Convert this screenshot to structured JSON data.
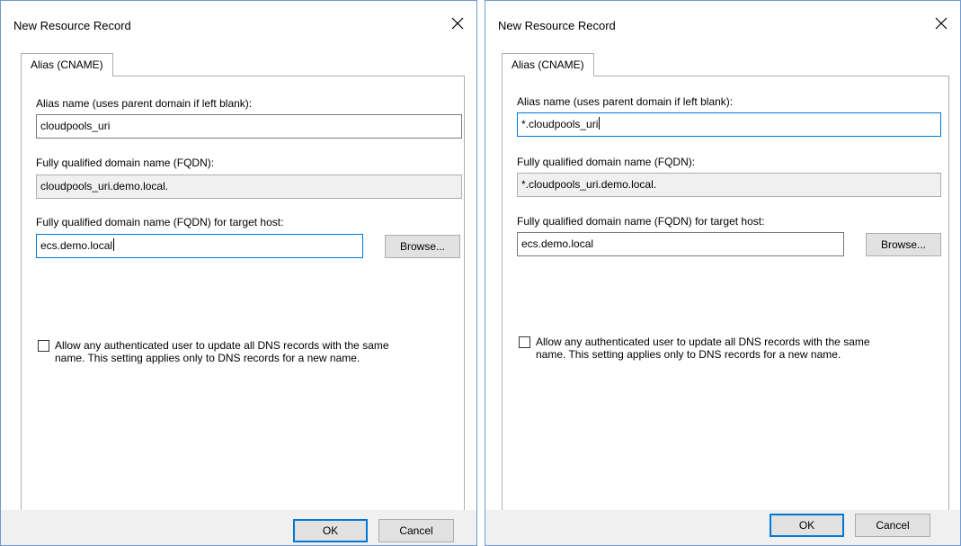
{
  "dialogs": [
    {
      "title": "New Resource Record",
      "tab_label": "Alias (CNAME)",
      "alias_label": "Alias name (uses parent domain if left blank):",
      "alias_value": "cloudpools_uri",
      "fqdn_label": "Fully qualified domain name (FQDN):",
      "fqdn_value": "cloudpools_uri.demo.local.",
      "target_label": "Fully qualified domain name (FQDN) for target host:",
      "target_value": "ecs.demo.local",
      "browse_label": "Browse...",
      "checkbox_line1": "Allow any authenticated user to update all DNS records with the same",
      "checkbox_line2": "name. This setting applies only to DNS records for a new name.",
      "ok_label": "OK",
      "cancel_label": "Cancel"
    },
    {
      "title": "New Resource Record",
      "tab_label": "Alias (CNAME)",
      "alias_label": "Alias name (uses parent domain if left blank):",
      "alias_value": "*.cloudpools_uri",
      "fqdn_label": "Fully qualified domain name (FQDN):",
      "fqdn_value": "*.cloudpools_uri.demo.local.",
      "target_label": "Fully qualified domain name (FQDN) for target host:",
      "target_value": "ecs.demo.local",
      "browse_label": "Browse...",
      "checkbox_line1": "Allow any authenticated user to update all DNS records with the same",
      "checkbox_line2": "name. This setting applies only to DNS records for a new name.",
      "ok_label": "OK",
      "cancel_label": "Cancel"
    }
  ],
  "icons": {
    "close": "close-icon"
  }
}
